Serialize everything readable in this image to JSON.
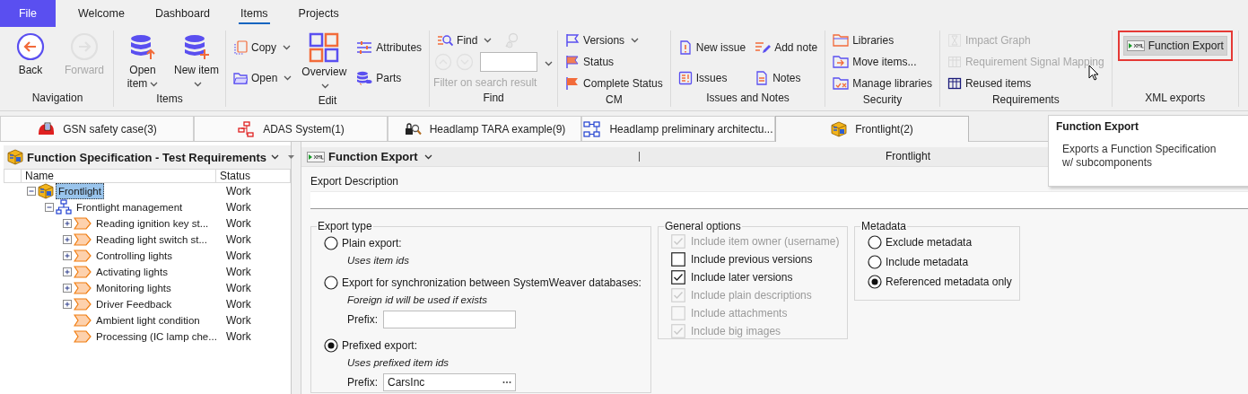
{
  "menu_tabs": [
    {
      "label": "File",
      "kind": "file",
      "selected": false
    },
    {
      "label": "Welcome",
      "kind": "tab",
      "selected": false
    },
    {
      "label": "Dashboard",
      "kind": "tab",
      "selected": false
    },
    {
      "label": "Items",
      "kind": "tab",
      "selected": true
    },
    {
      "label": "Projects",
      "kind": "tab",
      "selected": false
    }
  ],
  "ribbon": {
    "groups": [
      {
        "label": "Navigation",
        "columns": [
          [
            [
              {
                "kind": "large",
                "label": "Back",
                "disabled": false,
                "dropdown": false,
                "highlighted": false
              }
            ]
          ],
          [
            [
              {
                "kind": "large",
                "label": "Forward",
                "disabled": true,
                "dropdown": false,
                "highlighted": false
              }
            ]
          ]
        ]
      },
      {
        "label": "Items",
        "columns": [
          [
            [
              {
                "kind": "large",
                "label": "Open item",
                "disabled": false,
                "dropdown": true,
                "highlighted": false
              }
            ]
          ],
          [
            [
              {
                "kind": "large",
                "label": "New item",
                "disabled": false,
                "dropdown": true,
                "highlighted": false
              }
            ]
          ]
        ]
      },
      {
        "label": "Edit",
        "columns": [
          [
            [
              {
                "kind": "small",
                "label": "Copy",
                "disabled": false,
                "dropdown": true,
                "highlighted": false
              }
            ],
            [
              {
                "kind": "small",
                "label": "Open",
                "disabled": false,
                "dropdown": true,
                "highlighted": false
              }
            ]
          ],
          [
            [
              {
                "kind": "large",
                "label": "Overview",
                "disabled": false,
                "dropdown": true,
                "highlighted": false
              }
            ]
          ],
          [
            [
              {
                "kind": "small",
                "label": "Attributes",
                "disabled": false,
                "dropdown": false,
                "highlighted": false
              }
            ],
            [
              {
                "kind": "small",
                "label": "Parts",
                "disabled": false,
                "dropdown": false,
                "highlighted": false
              }
            ]
          ]
        ]
      },
      {
        "label": "Find",
        "columns": [
          [
            [
              {
                "kind": "small",
                "label": "Find",
                "disabled": false,
                "dropdown": true,
                "highlighted": false
              },
              {
                "kind": "icon",
                "disabled": true,
                "dropdown": false,
                "highlighted": false
              }
            ],
            [
              {
                "kind": "icon",
                "disabled": true,
                "dropdown": false,
                "highlighted": false
              },
              {
                "kind": "icon",
                "disabled": true,
                "dropdown": false,
                "highlighted": false
              },
              {
                "kind": "input",
                "disabled": false,
                "dropdown": false,
                "highlighted": false
              }
            ],
            [
              {
                "kind": "caption",
                "label": "Filter on search result",
                "disabled": true,
                "dropdown": false,
                "highlighted": false
              }
            ]
          ],
          [
            [
              {
                "kind": "menu",
                "disabled": false,
                "dropdown": true,
                "highlighted": false
              }
            ]
          ]
        ]
      },
      {
        "label": "CM",
        "columns": [
          [
            [
              {
                "kind": "small",
                "label": "Versions",
                "disabled": false,
                "dropdown": true,
                "highlighted": false
              }
            ],
            [
              {
                "kind": "small",
                "label": "Status",
                "disabled": false,
                "dropdown": false,
                "highlighted": false
              }
            ],
            [
              {
                "kind": "small",
                "label": "Complete Status",
                "disabled": false,
                "dropdown": false,
                "highlighted": false
              }
            ]
          ]
        ]
      },
      {
        "label": "Issues and Notes",
        "columns": [
          [
            [
              {
                "kind": "small",
                "label": "New issue",
                "disabled": false,
                "dropdown": false,
                "highlighted": false
              }
            ],
            [
              {
                "kind": "small",
                "label": "Issues",
                "disabled": false,
                "dropdown": false,
                "highlighted": false
              }
            ]
          ],
          [
            [
              {
                "kind": "small",
                "label": "Add note",
                "disabled": false,
                "dropdown": false,
                "highlighted": false
              }
            ],
            [
              {
                "kind": "small",
                "label": "Notes",
                "disabled": false,
                "dropdown": false,
                "highlighted": false
              }
            ]
          ]
        ]
      },
      {
        "label": "Security",
        "columns": [
          [
            [
              {
                "kind": "small",
                "label": "Libraries",
                "disabled": false,
                "dropdown": false,
                "highlighted": false
              }
            ],
            [
              {
                "kind": "small",
                "label": "Move items...",
                "disabled": false,
                "dropdown": false,
                "highlighted": false
              }
            ],
            [
              {
                "kind": "small",
                "label": "Manage libraries",
                "disabled": false,
                "dropdown": false,
                "highlighted": false
              }
            ]
          ]
        ]
      },
      {
        "label": "Requirements",
        "columns": [
          [
            [
              {
                "kind": "small",
                "label": "Impact Graph",
                "disabled": true,
                "dropdown": false,
                "highlighted": false
              }
            ],
            [
              {
                "kind": "small",
                "label": "Requirement Signal Mapping",
                "disabled": true,
                "dropdown": false,
                "highlighted": false
              }
            ],
            [
              {
                "kind": "small",
                "label": "Reused items",
                "disabled": false,
                "dropdown": false,
                "highlighted": false
              }
            ]
          ]
        ]
      },
      {
        "label": "XML exports",
        "columns": [
          [
            [
              {
                "kind": "small",
                "label": "Function Export",
                "disabled": false,
                "dropdown": false,
                "highlighted": true
              }
            ]
          ]
        ]
      }
    ]
  },
  "doc_tabs": [
    {
      "label": "GSN safety case(3)",
      "selected": false
    },
    {
      "label": "ADAS System(1)",
      "selected": false
    },
    {
      "label": "Headlamp TARA example(9)",
      "selected": false
    },
    {
      "label": "Headlamp preliminary architectu...",
      "selected": false
    },
    {
      "label": "Frontlight(2)",
      "selected": true
    }
  ],
  "tree_pane": {
    "title": "Function Specification - Test Requirements",
    "columns": [
      "Name",
      "Status"
    ],
    "nodes": [
      {
        "name": "Frontlight",
        "status": "Work",
        "selected": true,
        "expanded": true,
        "children": [
          {
            "name": "Frontlight management",
            "status": "Work",
            "selected": false,
            "expanded": true,
            "children": [
              {
                "name": "Reading ignition key st...",
                "status": "Work",
                "selected": false,
                "expanded": false
              },
              {
                "name": "Reading light switch st...",
                "status": "Work",
                "selected": false,
                "expanded": false
              },
              {
                "name": "Controlling lights",
                "status": "Work",
                "selected": false,
                "expanded": false
              },
              {
                "name": "Activating lights",
                "status": "Work",
                "selected": false,
                "expanded": false
              },
              {
                "name": "Monitoring lights",
                "status": "Work",
                "selected": false,
                "expanded": false
              },
              {
                "name": "Driver Feedback",
                "status": "Work",
                "selected": false,
                "expanded": false
              },
              {
                "name": "Ambient light condition",
                "status": "Work",
                "selected": false
              },
              {
                "name": "Processing (IC lamp che...",
                "status": "Work",
                "selected": false
              }
            ]
          }
        ]
      }
    ]
  },
  "export_pane": {
    "title": "Function Export",
    "item": "Frontlight",
    "description_label": "Export Description",
    "export_type": {
      "title": "Export type",
      "options": [
        {
          "label": "Plain export:",
          "hint": "Uses item ids",
          "selected": false
        },
        {
          "label": "Export for synchronization between SystemWeaver databases:",
          "hint": "Foreign id will be used if exists",
          "selected": false,
          "prefix_label": "Prefix:",
          "browse": false
        },
        {
          "label": "Prefixed export:",
          "hint": "Uses prefixed item ids",
          "selected": true,
          "prefix_label": "Prefix:",
          "prefix_value": "CarsInc",
          "browse": true
        }
      ]
    },
    "general_options": {
      "title": "General options",
      "options": [
        {
          "label": "Include item owner (username)",
          "checked": true,
          "disabled": true
        },
        {
          "label": "Include previous versions",
          "checked": false,
          "disabled": false
        },
        {
          "label": "Include later versions",
          "checked": true,
          "disabled": false
        },
        {
          "label": "Include plain descriptions",
          "checked": true,
          "disabled": true
        },
        {
          "label": "Include attachments",
          "checked": false,
          "disabled": true
        },
        {
          "label": "Include big images",
          "checked": true,
          "disabled": true
        }
      ]
    },
    "metadata": {
      "title": "Metadata",
      "options": [
        {
          "label": "Exclude metadata",
          "selected": false
        },
        {
          "label": "Include metadata",
          "selected": false
        },
        {
          "label": "Referenced metadata only",
          "selected": true
        }
      ]
    }
  },
  "tooltip": {
    "title": "Function Export",
    "text": "Exports a Function Specification w/ subcomponents"
  }
}
